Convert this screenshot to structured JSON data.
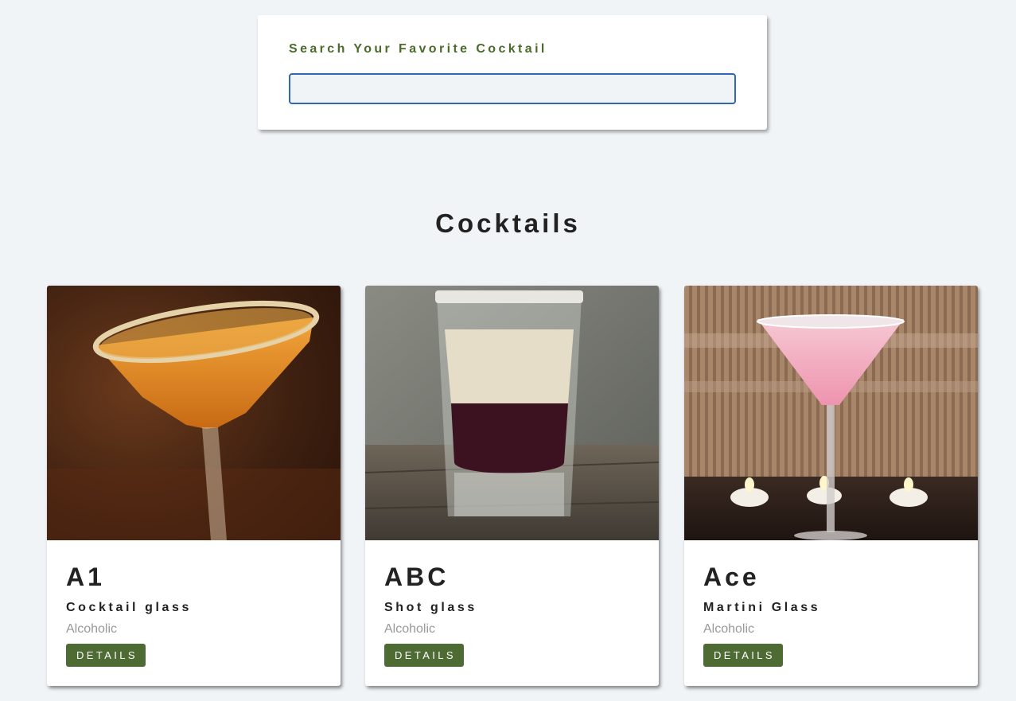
{
  "search": {
    "label": "Search Your Favorite Cocktail",
    "value": "",
    "placeholder": ""
  },
  "section": {
    "title": "Cocktails"
  },
  "cocktails": [
    {
      "name": "A1",
      "glass": "Cocktail glass",
      "type": "Alcoholic",
      "button": "DETAILS"
    },
    {
      "name": "ABC",
      "glass": "Shot glass",
      "type": "Alcoholic",
      "button": "DETAILS"
    },
    {
      "name": "Ace",
      "glass": "Martini Glass",
      "type": "Alcoholic",
      "button": "DETAILS"
    }
  ],
  "colors": {
    "page_bg": "#f0f4f7",
    "accent_green": "#4f6b34",
    "label_green": "#4a6b2a",
    "input_border": "#3366b3"
  }
}
